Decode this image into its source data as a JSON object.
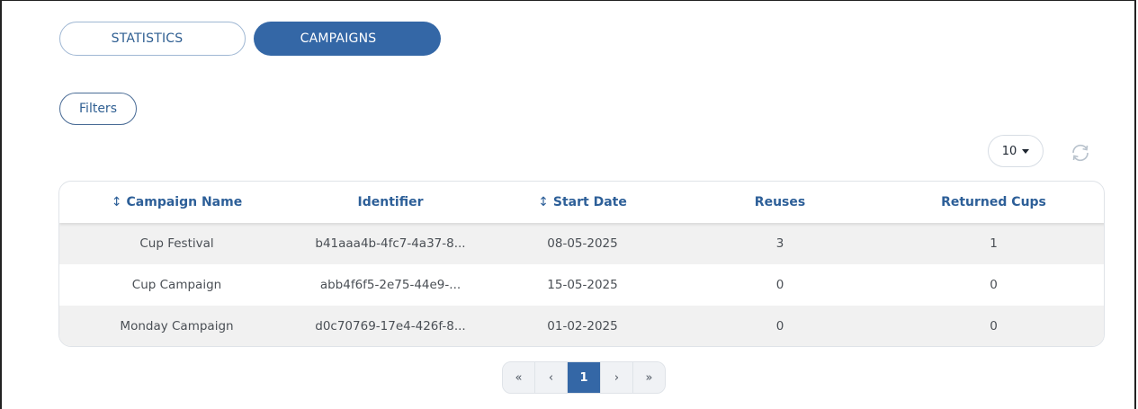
{
  "tabs": [
    {
      "label": "STATISTICS",
      "active": false
    },
    {
      "label": "CAMPAIGNS",
      "active": true
    }
  ],
  "filters_label": "Filters",
  "page_size": {
    "value": "10"
  },
  "table": {
    "headers": [
      {
        "label": "Campaign Name",
        "sortable": true
      },
      {
        "label": "Identifier",
        "sortable": false
      },
      {
        "label": "Start Date",
        "sortable": true
      },
      {
        "label": "Reuses",
        "sortable": false
      },
      {
        "label": "Returned Cups",
        "sortable": false
      }
    ],
    "rows": [
      [
        "Cup Festival",
        "b41aaa4b-4fc7-4a37-8...",
        "08-05-2025",
        "3",
        "1"
      ],
      [
        "Cup Campaign",
        "abb4f6f5-2e75-44e9-...",
        "15-05-2025",
        "0",
        "0"
      ],
      [
        "Monday Campaign",
        "d0c70769-17e4-426f-8...",
        "01-02-2025",
        "0",
        "0"
      ]
    ]
  },
  "pagination": {
    "first": "«",
    "prev": "‹",
    "current": "1",
    "next": "›",
    "last": "»"
  },
  "icons": {
    "sort": "↕",
    "refresh": "refresh-icon",
    "dropdown": "caret-down-icon"
  },
  "colors": {
    "primary": "#3467a6",
    "header_text": "#2d5f98",
    "row_stripe": "#f1f1f1"
  }
}
